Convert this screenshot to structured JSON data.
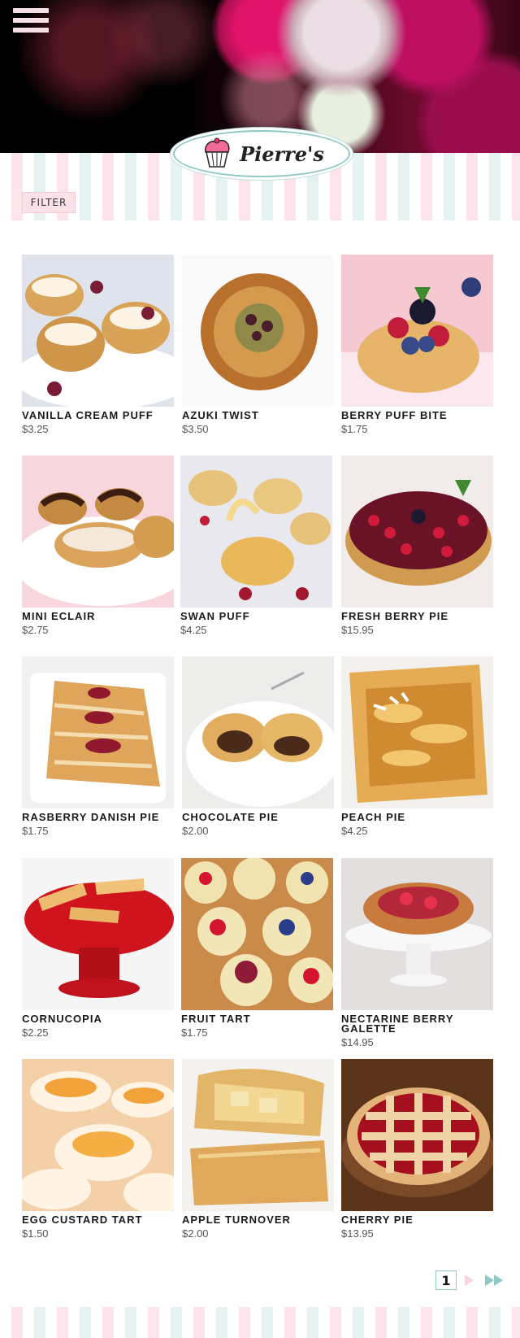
{
  "header": {
    "brand": "Pierre's"
  },
  "filter": {
    "label": "FILTER"
  },
  "products": [
    {
      "name": "VANILLA CREAM PUFF",
      "price": "$3.25"
    },
    {
      "name": "AZUKI TWIST",
      "price": "$3.50"
    },
    {
      "name": "BERRY PUFF BITE",
      "price": "$1.75"
    },
    {
      "name": "MINI ECLAIR",
      "price": "$2.75"
    },
    {
      "name": "SWAN PUFF",
      "price": "$4.25"
    },
    {
      "name": "FRESH BERRY PIE",
      "price": "$15.95"
    },
    {
      "name": "RASBERRY DANISH PIE",
      "price": "$1.75"
    },
    {
      "name": "CHOCOLATE PIE",
      "price": "$2.00"
    },
    {
      "name": "PEACH PIE",
      "price": "$4.25"
    },
    {
      "name": "CORNUCOPIA",
      "price": "$2.25"
    },
    {
      "name": "FRUIT TART",
      "price": "$1.75"
    },
    {
      "name": "NECTARINE BERRY GALETTE",
      "price": "$14.95"
    },
    {
      "name": "EGG CUSTARD TART",
      "price": "$1.50"
    },
    {
      "name": "APPLE TURNOVER",
      "price": "$2.00"
    },
    {
      "name": "CHERRY PIE",
      "price": "$13.95"
    }
  ],
  "pagination": {
    "current": "1"
  },
  "colors": {
    "accent_pink": "#fbe1e8",
    "accent_teal": "#8ec9c4"
  }
}
